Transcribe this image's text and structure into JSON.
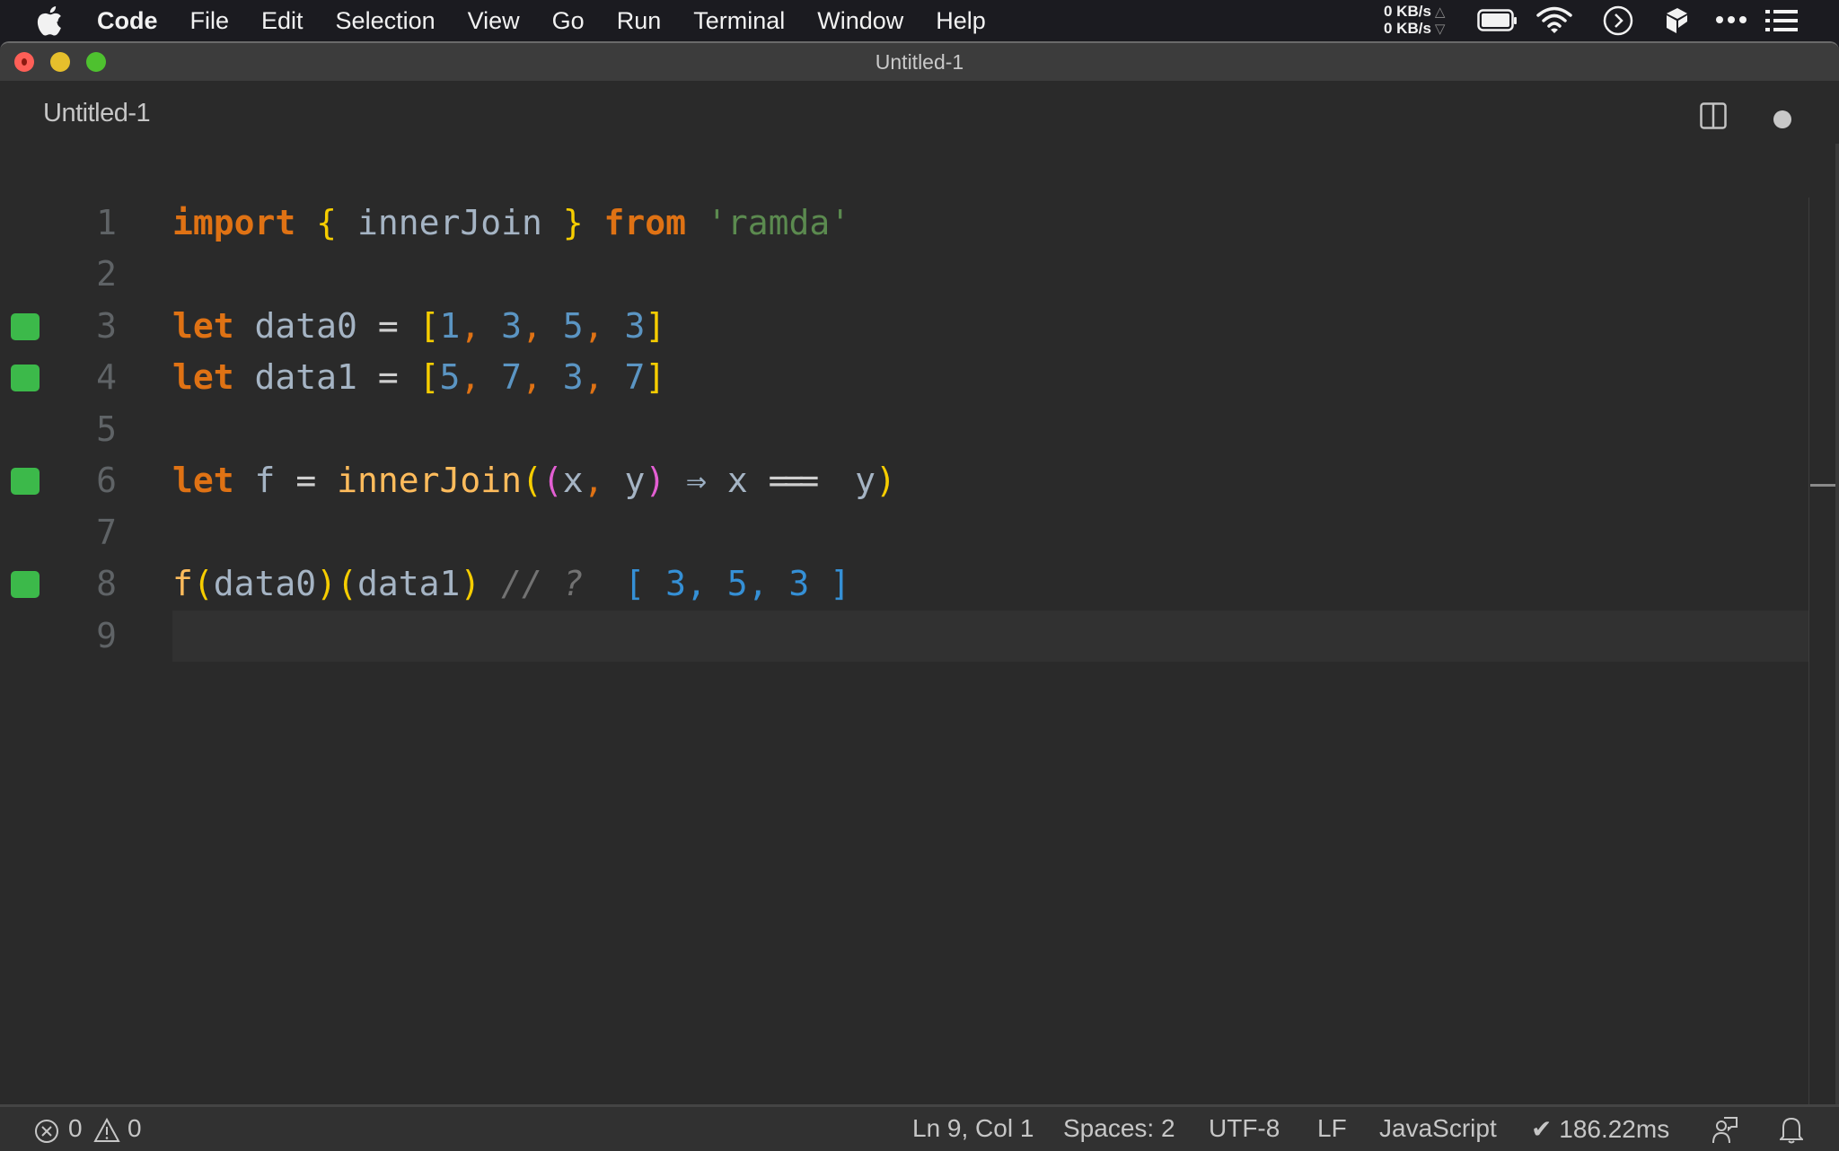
{
  "menubar": {
    "app_name": "Code",
    "items": [
      "File",
      "Edit",
      "Selection",
      "View",
      "Go",
      "Run",
      "Terminal",
      "Window",
      "Help"
    ],
    "net_up": "0 KB/s",
    "net_down": "0 KB/s",
    "net_up_arrow": "△",
    "net_down_arrow": "▽",
    "tray_icons": [
      "battery-icon",
      "wifi-icon",
      "play-circle-icon",
      "cube-icon",
      "more-icon",
      "list-icon"
    ]
  },
  "window": {
    "title": "Untitled-1"
  },
  "tab": {
    "label": "Untitled-1",
    "dirty": true
  },
  "editor": {
    "lines": [
      {
        "n": "1",
        "marker": false
      },
      {
        "n": "2",
        "marker": false
      },
      {
        "n": "3",
        "marker": true
      },
      {
        "n": "4",
        "marker": true
      },
      {
        "n": "5",
        "marker": false
      },
      {
        "n": "6",
        "marker": true
      },
      {
        "n": "7",
        "marker": false
      },
      {
        "n": "8",
        "marker": true
      },
      {
        "n": "9",
        "marker": false,
        "current": true
      }
    ],
    "code": {
      "l1": {
        "import": "import",
        "ob": "{",
        "name": "innerJoin",
        "cb": "}",
        "from": "from",
        "module": "'ramda'"
      },
      "l3": {
        "let": "let",
        "var": "data0",
        "eq": "=",
        "ob": "[",
        "v": [
          "1",
          "3",
          "5",
          "3"
        ],
        "cb": "]"
      },
      "l4": {
        "let": "let",
        "var": "data1",
        "eq": "=",
        "ob": "[",
        "v": [
          "5",
          "7",
          "3",
          "7"
        ],
        "cb": "]"
      },
      "l6": {
        "let": "let",
        "var": "f",
        "eq": "=",
        "fn": "innerJoin",
        "op": "(",
        "pop": "(",
        "x": "x",
        "y": "y",
        "pcl": ")",
        "arrow": "⇒",
        "x2": "x",
        "eqeq": "===",
        "y2": "y",
        "cl": ")"
      },
      "l8": {
        "fn": "f",
        "arg1": "data0",
        "arg2": "data1",
        "comment": "// ?",
        "result": "[ 3, 5, 3 ]"
      }
    }
  },
  "statusbar": {
    "errors": "0",
    "warnings": "0",
    "position": "Ln 9, Col 1",
    "indent": "Spaces: 2",
    "encoding": "UTF-8",
    "eol": "LF",
    "language": "JavaScript",
    "timing": "✔ 186.22ms"
  }
}
